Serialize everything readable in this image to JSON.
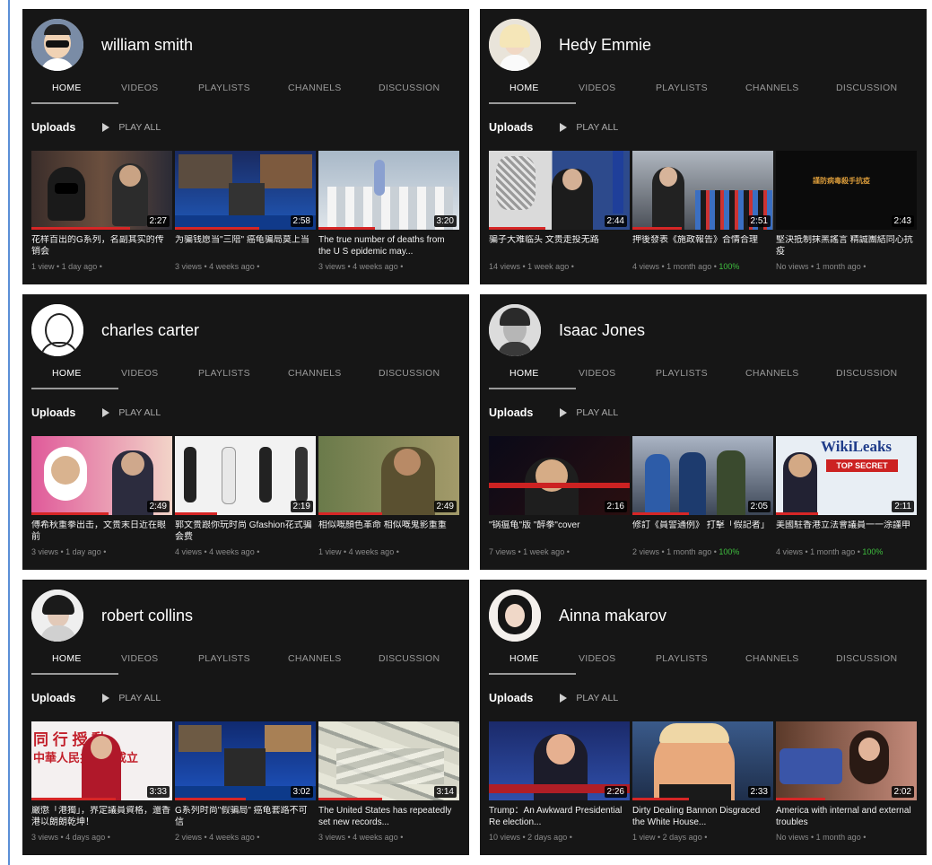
{
  "colors": {
    "panel_bg": "#161616",
    "accent_red": "#d62626",
    "green_pct": "#3fbf3f",
    "border_blue": "#5b8fd6"
  },
  "tabs": [
    "HOME",
    "VIDEOS",
    "PLAYLISTS",
    "CHANNELS",
    "DISCUSSION"
  ],
  "uploads_label": "Uploads",
  "play_all_label": "PLAY ALL",
  "channels": [
    {
      "name": "william smith",
      "videos": [
        {
          "title": "花样百出的G系列，名副其实的传销会",
          "duration": "2:27",
          "meta": "1 view • 1 day ago •",
          "pct": ""
        },
        {
          "title": "为骗钱愿当\"三陪\" 癌龟骗局莫上当",
          "duration": "2:58",
          "meta": "3 views • 4 weeks ago •",
          "pct": ""
        },
        {
          "title": "The true number of deaths from the U S epidemic may...",
          "duration": "3:20",
          "meta": "3 views • 4 weeks ago •",
          "pct": ""
        }
      ]
    },
    {
      "name": "Hedy Emmie",
      "videos": [
        {
          "title": "骗子大难临头 文贵走投无路",
          "duration": "2:44",
          "meta": "14 views • 1 week ago •",
          "pct": ""
        },
        {
          "title": "押後發表《施政報告》合情合理",
          "duration": "2:51",
          "meta": "4 views • 1 month ago •",
          "pct": "100%"
        },
        {
          "title": "堅決抵制抹黑謠言 精誠團結同心抗疫",
          "duration": "2:43",
          "meta": "No views • 1 month ago •",
          "pct": ""
        }
      ]
    },
    {
      "name": "charles carter",
      "videos": [
        {
          "title": "傅希秋重拳出击，文贵末日近在眼前",
          "duration": "2:49",
          "meta": "3 views • 1 day ago •",
          "pct": ""
        },
        {
          "title": "郭文贵跟你玩时尚 Gfashion花式骗会费",
          "duration": "2:19",
          "meta": "4 views • 4 weeks ago •",
          "pct": ""
        },
        {
          "title": "相似嘅顏色革命 相似嘅鬼影重重",
          "duration": "2:49",
          "meta": "1 view • 4 weeks ago •",
          "pct": ""
        }
      ]
    },
    {
      "name": "Isaac Jones",
      "videos": [
        {
          "title": "\"锅瘟龟\"版 \"醉拳\"cover",
          "duration": "2:16",
          "meta": "7 views • 1 week ago •",
          "pct": ""
        },
        {
          "title": "修訂《員警通例》 打擊「假記者」",
          "duration": "2:05",
          "meta": "2 views • 1 month ago •",
          "pct": "100%"
        },
        {
          "title": "美國駐香港立法會議員一一涂謹申",
          "duration": "2:11",
          "meta": "4 views • 1 month ago •",
          "pct": "100%"
        }
      ]
    },
    {
      "name": "robert collins",
      "videos": [
        {
          "title": "嚴懲「港獨」，界定議員資格，還香港以朗朗乾坤！",
          "duration": "3:33",
          "meta": "3 views • 4 days ago •",
          "pct": ""
        },
        {
          "title": "G系列时尚\"假骗局\" 癌龟套路不可信",
          "duration": "3:02",
          "meta": "2 views • 4 weeks ago •",
          "pct": ""
        },
        {
          "title": "The United States has repeatedly set new records...",
          "duration": "3:14",
          "meta": "3 views • 4 weeks ago •",
          "pct": ""
        }
      ]
    },
    {
      "name": "Ainna makarov",
      "videos": [
        {
          "title": "Trump：An Awkward Presidential Re election...",
          "duration": "2:26",
          "meta": "10 views • 2 days ago •",
          "pct": ""
        },
        {
          "title": "Dirty Dealing Bannon Disgraced the White House...",
          "duration": "2:33",
          "meta": "1 view • 2 days ago •",
          "pct": ""
        },
        {
          "title": "America with internal and external troubles",
          "duration": "2:02",
          "meta": "No views • 1 month ago •",
          "pct": ""
        }
      ]
    }
  ],
  "thumb_text": {
    "t1_5_line1": "同 行  授 動",
    "t1_5_line2": "中華人民共和國成立",
    "t2_3_text": "謹防病毒殺手抗疫",
    "t2_5_wiki": "WikiLeaks",
    "t2_5_secret": "TOP SECRET"
  }
}
